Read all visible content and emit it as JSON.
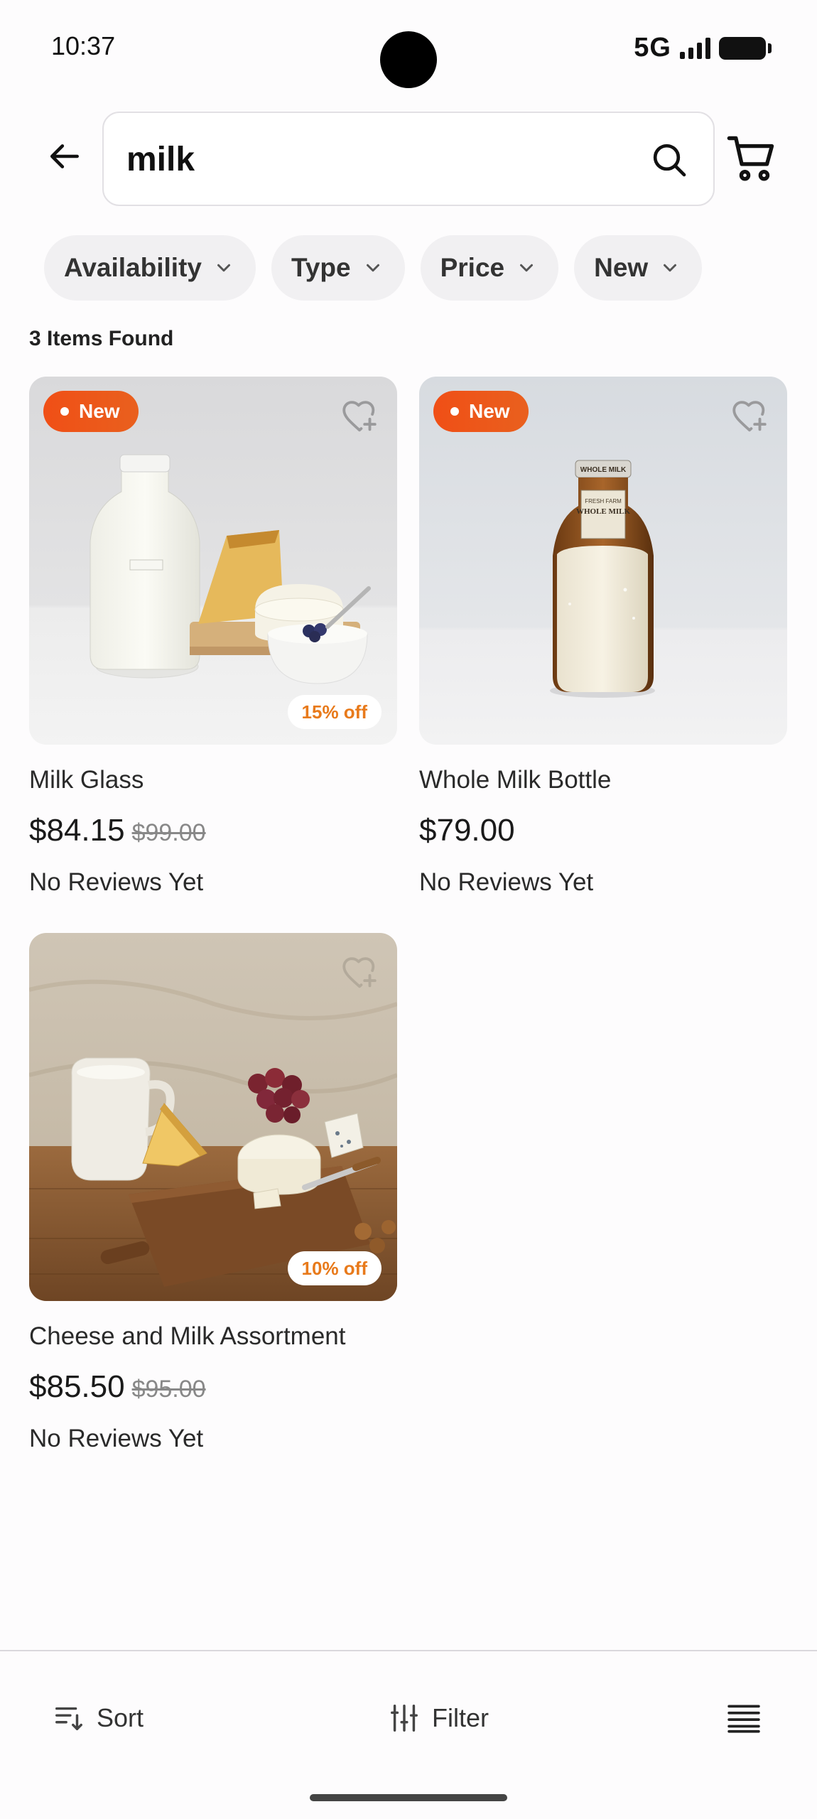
{
  "status_bar": {
    "time": "10:37",
    "network": "5G"
  },
  "search": {
    "value": "milk"
  },
  "filters": [
    {
      "label": "Availability"
    },
    {
      "label": "Type"
    },
    {
      "label": "Price"
    },
    {
      "label": "New"
    }
  ],
  "results": {
    "count_text": "3 Items Found"
  },
  "products": [
    {
      "name": "Milk Glass",
      "price": "$84.15",
      "old_price": "$99.00",
      "badge": "New",
      "discount": "15% off",
      "reviews": "No Reviews Yet",
      "image": "milk-glass-photo"
    },
    {
      "name": "Whole Milk Bottle",
      "price": "$79.00",
      "old_price": "",
      "badge": "New",
      "discount": "",
      "reviews": "No Reviews Yet",
      "image": "whole-milk-bottle-photo",
      "label_text": {
        "brand": "WHOLE MILK",
        "line1": "FRESH FARM",
        "line2": "WHOLE MILK"
      }
    },
    {
      "name": "Cheese and Milk Assortment",
      "price": "$85.50",
      "old_price": "$95.00",
      "badge": "",
      "discount": "10% off",
      "reviews": "No Reviews Yet",
      "image": "cheese-milk-assortment-photo"
    }
  ],
  "bottom_bar": {
    "sort_label": "Sort",
    "filter_label": "Filter"
  },
  "colors": {
    "accent": "#f04f16",
    "discount_text": "#e87a1b",
    "chip_bg": "#f1f0f2"
  }
}
